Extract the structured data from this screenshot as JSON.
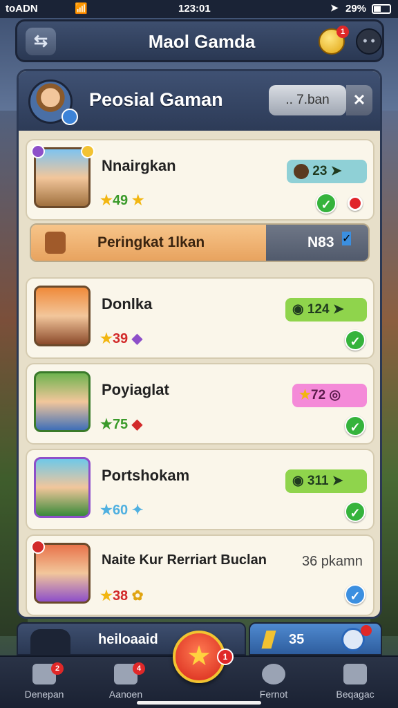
{
  "status_bar": {
    "carrier": "toADN",
    "time": "123:01",
    "battery": "29%"
  },
  "header": {
    "title": "Maol Gamda",
    "coin_badge": "1"
  },
  "panel": {
    "title": "Peosial Gaman",
    "pill_label": ".. 7.ban",
    "close_label": "✕"
  },
  "players": [
    {
      "name": "Nnairgkan",
      "score": "49",
      "chip": "23",
      "chip_color": "#8fd0d6"
    },
    {
      "name": "Donlka",
      "score": "39",
      "chip": "124",
      "chip_color": "#8fd44c"
    },
    {
      "name": "Poyiaglat",
      "score": "75",
      "chip": "72",
      "chip_color": "#f48ad8"
    },
    {
      "name": "Portshokam",
      "score": "60",
      "chip": "311",
      "chip_color": "#8fd44c"
    },
    {
      "name": "Naite Kur Rerriart Buclan",
      "score": "38",
      "side_text": "36 pkamn"
    }
  ],
  "rank_bar": {
    "label": "Peringkat 1lkan",
    "value": "N83"
  },
  "bottom_strip": {
    "leaderboard_label": "heiloaaid",
    "gems": "35"
  },
  "tabbar": {
    "tabs": [
      {
        "label": "Denepan",
        "badge": "2"
      },
      {
        "label": "Aanoen",
        "badge": "4"
      },
      {
        "label": "Fernot"
      },
      {
        "label": "Beqagac"
      }
    ],
    "center_badge": "1"
  }
}
